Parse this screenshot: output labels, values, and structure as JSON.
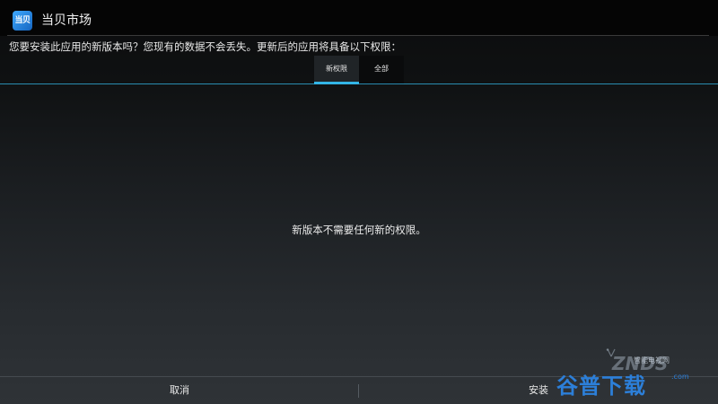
{
  "app": {
    "title": "当贝市场",
    "icon_text": "当贝",
    "icon": "dangbei-app-icon"
  },
  "install": {
    "prompt": "您要安装此应用的新版本吗？您现有的数据不会丢失。更新后的应用将具备以下权限：",
    "tabs": [
      {
        "label": "新权限",
        "selected": true
      },
      {
        "label": "全部",
        "selected": false
      }
    ],
    "message": "新版本不需要任何新的权限。",
    "buttons": {
      "cancel": "取消",
      "install": "安装"
    }
  },
  "watermark": {
    "text_cn": "谷普下载",
    "logo": "ZNDS",
    "subtitle": "智能电视网",
    "domain": ".com"
  },
  "colors": {
    "accent": "#33b5e5",
    "background": "#0f1112",
    "watermark_blue": "#2c7fd9"
  }
}
